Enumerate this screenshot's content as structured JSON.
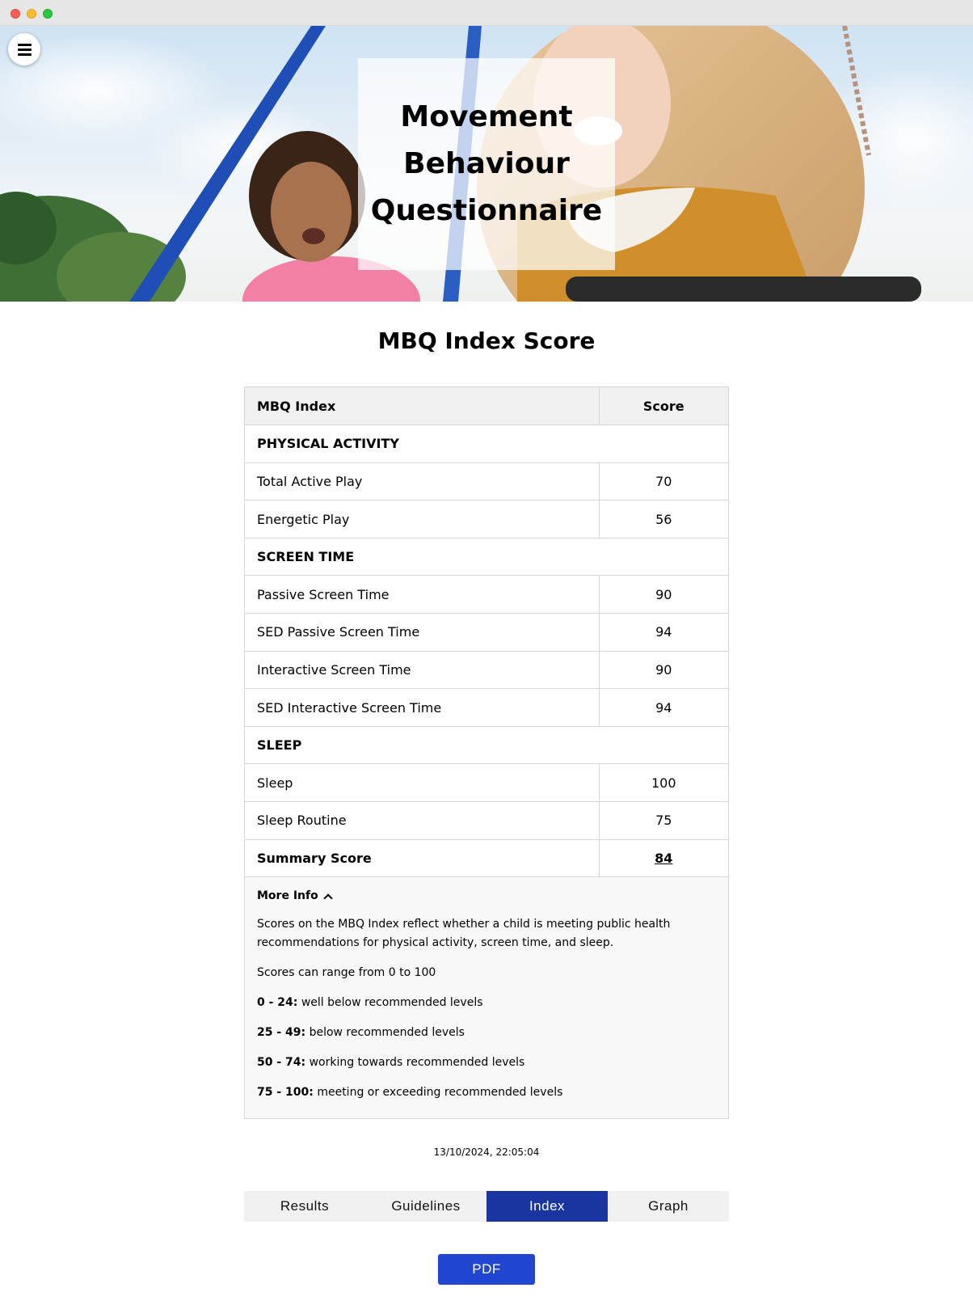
{
  "app": {
    "title": "Movement Behaviour Questionnaire",
    "title_lines": [
      "Movement",
      "Behaviour",
      "Questionnaire"
    ],
    "menu_icon": "hamburger-icon"
  },
  "page": {
    "heading": "MBQ Index Score"
  },
  "table": {
    "headers": {
      "index": "MBQ Index",
      "score": "Score"
    },
    "groups": [
      {
        "label": "PHYSICAL ACTIVITY",
        "rows": [
          {
            "name": "Total Active Play",
            "score": "70"
          },
          {
            "name": "Energetic Play",
            "score": "56"
          }
        ]
      },
      {
        "label": "SCREEN TIME",
        "rows": [
          {
            "name": "Passive Screen Time",
            "score": "90"
          },
          {
            "name": "SED Passive Screen Time",
            "score": "94"
          },
          {
            "name": "Interactive Screen Time",
            "score": "90"
          },
          {
            "name": "SED Interactive Screen Time",
            "score": "94"
          }
        ]
      },
      {
        "label": "SLEEP",
        "rows": [
          {
            "name": "Sleep",
            "score": "100"
          },
          {
            "name": "Sleep Routine",
            "score": "75"
          }
        ]
      }
    ],
    "summary": {
      "label": "Summary Score",
      "score": "84"
    }
  },
  "more_info": {
    "toggle_label": "More Info",
    "toggle_icon": "chevron-up-icon",
    "description": "Scores on the MBQ Index reflect whether a child is meeting public health recommendations for physical activity, screen time, and sleep.",
    "range_text": "Scores can range from 0 to 100",
    "levels": [
      {
        "range": "0 - 24:",
        "text": "well below recommended levels"
      },
      {
        "range": "25 - 49:",
        "text": "below recommended levels"
      },
      {
        "range": "50 - 74:",
        "text": "working towards recommended levels"
      },
      {
        "range": "75 - 100:",
        "text": "meeting or exceeding recommended levels"
      }
    ]
  },
  "timestamp": "13/10/2024, 22:05:04",
  "tabs": {
    "items": [
      "Results",
      "Guidelines",
      "Index",
      "Graph"
    ],
    "active": "Index"
  },
  "pdf_button": "PDF",
  "colors": {
    "tab_active": "#1b35a0",
    "pdf_button": "#2146d0",
    "table_header_bg": "#f1f1f1",
    "more_info_bg": "#f8f8f8"
  }
}
